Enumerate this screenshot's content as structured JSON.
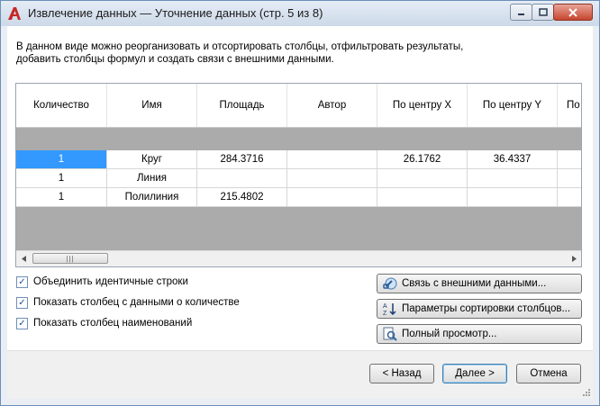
{
  "window": {
    "title": "Извлечение данных — Уточнение данных (стр. 5 из 8)",
    "app_icon": "autocad-a-icon"
  },
  "description": {
    "line1": "В данном виде можно реорганизовать и отсортировать столбцы, отфильтровать результаты,",
    "line2": "добавить столбцы формул и создать связи с внешними данными."
  },
  "table": {
    "columns": [
      "Количество",
      "Имя",
      "Площадь",
      "Автор",
      "По центру X",
      "По центру Y",
      "По"
    ],
    "rows": [
      [
        "1",
        "Круг",
        "284.3716",
        "",
        "26.1762",
        "36.4337",
        ""
      ],
      [
        "1",
        "Линия",
        "",
        "",
        "",
        "",
        ""
      ],
      [
        "1",
        "Полилиния",
        "215.4802",
        "",
        "",
        "",
        ""
      ]
    ],
    "selected_cell": "Количество, row 1",
    "scroll_thumb_glyph": "|||"
  },
  "options": {
    "combine_identical_rows": {
      "label": "Объединить идентичные строки",
      "checked": true
    },
    "show_count_column": {
      "label": "Показать столбец с данными о количестве",
      "checked": true
    },
    "show_name_column": {
      "label": "Показать столбец наименований",
      "checked": true
    }
  },
  "actions": {
    "link_external": "Связь с внешними данными...",
    "sort_params": "Параметры сортировки столбцов...",
    "full_preview": "Полный просмотр..."
  },
  "nav": {
    "back": "< Назад",
    "next": "Далее >",
    "cancel": "Отмена"
  },
  "colors": {
    "selection": "#3399ff",
    "grid_empty": "#ababab",
    "autocad_red": "#c62828"
  }
}
